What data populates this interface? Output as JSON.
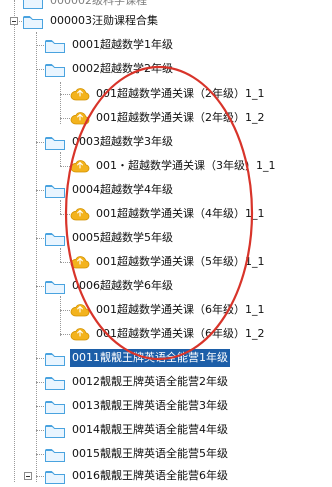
{
  "tree": {
    "top_partial_label": "000002级科学课程",
    "root_label": "000003汪勋课程合集",
    "nodes": [
      {
        "label": "0001超越数学1年级"
      },
      {
        "label": "0002超越数学2年级"
      },
      {
        "label": "001超越数学通关课（2年级）1_1"
      },
      {
        "label": "001超越数学通关课（2年级）1_2"
      },
      {
        "label": "0003超越数学3年级"
      },
      {
        "label": "001・超越数学通关课（3年级）1_1"
      },
      {
        "label": "0004超越数学4年级"
      },
      {
        "label": "001超越数学通关课（4年级）1_1"
      },
      {
        "label": "0005超越数学5年级"
      },
      {
        "label": "001超越数学通关课（5年级）1_1"
      },
      {
        "label": "0006超越数学6年级"
      },
      {
        "label": "001超越数学通关课（6年级）1_1"
      },
      {
        "label": "001超越数学通关课（6年级）1_2"
      },
      {
        "label": "0011靓靓王牌英语全能营1年级"
      },
      {
        "label": "0012靓靓王牌英语全能营2年级"
      },
      {
        "label": "0013靓靓王牌英语全能营3年级"
      },
      {
        "label": "0014靓靓王牌英语全能营4年级"
      },
      {
        "label": "0015靓靓王牌英语全能营5年级"
      },
      {
        "label": "0016靓靓王牌英语全能营6年级"
      }
    ]
  },
  "colors": {
    "selection": "#1c5ea8",
    "annotation_circle": "#d8342a",
    "folder": "#4aa3df",
    "cloud": "#f0b11a"
  },
  "icons": [
    "folder-icon",
    "cloud-icon",
    "expander-minus-icon",
    "expander-plus-icon"
  ]
}
